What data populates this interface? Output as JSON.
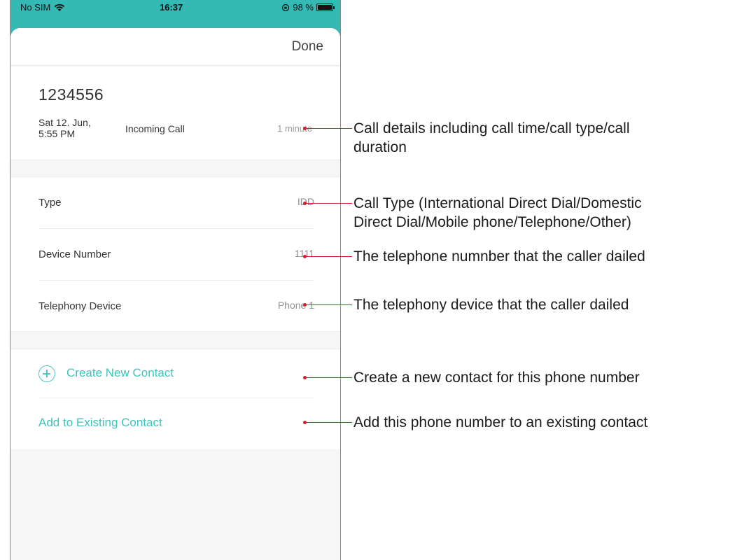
{
  "status_bar": {
    "carrier": "No SIM",
    "time": "16:37",
    "battery_text": "98 %",
    "battery_level": 0.98
  },
  "header": {
    "done_label": "Done"
  },
  "call": {
    "number": "1234556",
    "date_line1": "Sat 12. Jun,",
    "date_line2": "5:55 PM",
    "kind": "Incoming Call",
    "duration": "1 minute"
  },
  "details": [
    {
      "label": "Type",
      "value": "IDD"
    },
    {
      "label": "Device Number",
      "value": "1111"
    },
    {
      "label": "Telephony Device",
      "value": "Phone 1"
    }
  ],
  "actions": {
    "create_label": "Create New Contact",
    "add_label": "Add to Existing Contact"
  },
  "annotations": {
    "call_details_line1": "Call details including call time/call type/call",
    "call_details_line2": "duration",
    "call_type_line1": "Call Type (International Direct Dial/Domestic",
    "call_type_line2": "Direct Dial/Mobile phone/Telephone/Other)",
    "device_number": "The telephone numnber that the caller dailed",
    "telephony_device": "The telephony device that the caller dailed",
    "create_contact": "Create a new contact for this phone number",
    "add_contact": "Add this phone number to an existing contact"
  },
  "colors": {
    "accent": "#35b9b4",
    "link": "#3fc3bd",
    "annotation_line": "#d41f2b"
  }
}
